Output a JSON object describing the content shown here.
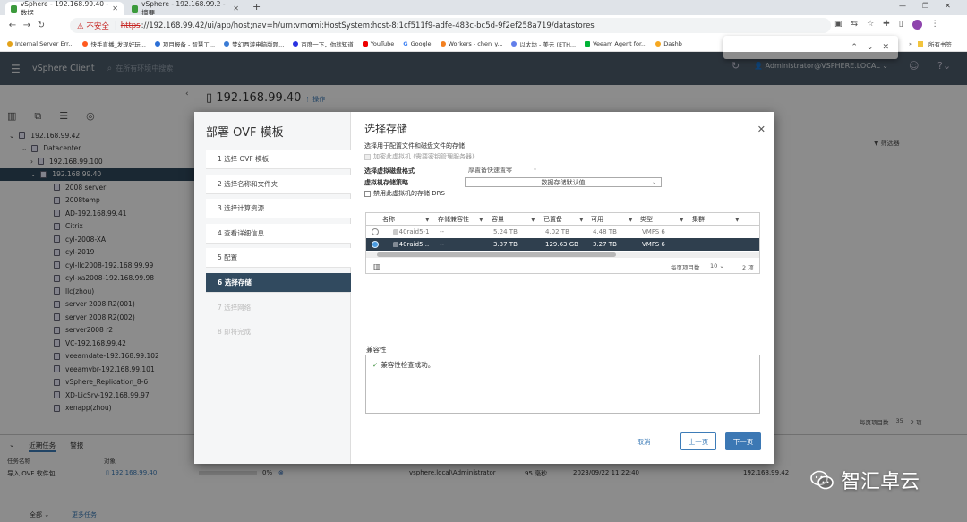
{
  "browser": {
    "tabs": [
      {
        "title": "vSphere - 192.168.99.40 - 数据"
      },
      {
        "title": "vSphere - 192.168.99.2 - 摘要"
      }
    ],
    "address": {
      "warning": "不安全",
      "scheme": "https",
      "rest": "://192.168.99.42/ui/app/host;nav=h/urn:vmomi:HostSystem:host-8:1cf511f9-adfe-483c-bc5d-9f2ef258a719/datastores"
    },
    "bookmarks": [
      "Internal Server Err...",
      "快手直播_发现好玩...",
      "项目报备 - 智慧工...",
      "梦幻西游电脑版题...",
      "百度一下，你就知道",
      "YouTube",
      "Google",
      "Workers - chen_y...",
      "以太坊 - 美元 (ETH...",
      "Veeam Agent for...",
      "Dashb"
    ],
    "all_bookmarks": "所有书签"
  },
  "vsphere": {
    "app_title": "vSphere Client",
    "search_placeholder": "在所有环境中搜索",
    "user": "Administrator@VSPHERE.LOCAL",
    "host_title": "192.168.99.40",
    "actions_label": "操作",
    "filter_label": "筛选器",
    "tree": [
      {
        "label": "192.168.99.42",
        "indent": 0,
        "selected": false
      },
      {
        "label": "Datacenter",
        "indent": 1,
        "selected": false
      },
      {
        "label": "192.168.99.100",
        "indent": 2,
        "selected": false
      },
      {
        "label": "192.168.99.40",
        "indent": 2,
        "selected": true
      },
      {
        "label": "2008 server",
        "indent": 3,
        "selected": false
      },
      {
        "label": "2008temp",
        "indent": 3,
        "selected": false
      },
      {
        "label": "AD-192.168.99.41",
        "indent": 3,
        "selected": false
      },
      {
        "label": "Citrix",
        "indent": 3,
        "selected": false
      },
      {
        "label": "cyl-2008-XA",
        "indent": 3,
        "selected": false
      },
      {
        "label": "cyl-2019",
        "indent": 3,
        "selected": false
      },
      {
        "label": "cyl-llc2008-192.168.99.99",
        "indent": 3,
        "selected": false
      },
      {
        "label": "cyl-xa2008-192.168.99.98",
        "indent": 3,
        "selected": false
      },
      {
        "label": "llc(zhou)",
        "indent": 3,
        "selected": false
      },
      {
        "label": "server 2008 R2(001)",
        "indent": 3,
        "selected": false
      },
      {
        "label": "server 2008 R2(002)",
        "indent": 3,
        "selected": false
      },
      {
        "label": "server2008 r2",
        "indent": 3,
        "selected": false
      },
      {
        "label": "VC-192.168.99.42",
        "indent": 3,
        "selected": false
      },
      {
        "label": "veeamdate-192.168.99.102",
        "indent": 3,
        "selected": false
      },
      {
        "label": "veeamvbr-192.168.99.101",
        "indent": 3,
        "selected": false
      },
      {
        "label": "vSphere_Replication_8-6",
        "indent": 3,
        "selected": false
      },
      {
        "label": "XD-LicSrv-192.168.99.97",
        "indent": 3,
        "selected": false
      },
      {
        "label": "xenapp(zhou)",
        "indent": 3,
        "selected": false
      }
    ],
    "right_footer": {
      "per_page_label": "每页项目数",
      "per_page": "35",
      "count": "2 项"
    },
    "bottom": {
      "tabs": [
        "近期任务",
        "警报"
      ],
      "columns": [
        "任务名称",
        "对象"
      ],
      "task": {
        "name": "导入 OVF 软件包",
        "target": "192.168.99.40",
        "progress": "0%",
        "initiator": "vsphere.local\\Administrator",
        "queued": "95 毫秒",
        "start": "2023/09/22 11:22:40",
        "server": "192.168.99.42"
      },
      "filter_all": "全部",
      "more_tasks": "更多任务"
    }
  },
  "modal": {
    "title": "部署 OVF 模板",
    "steps": [
      {
        "label": "1  选择 OVF 模板",
        "state": "done"
      },
      {
        "label": "2  选择名称和文件夹",
        "state": "done"
      },
      {
        "label": "3  选择计算资源",
        "state": "done"
      },
      {
        "label": "4  查看详细信息",
        "state": "done"
      },
      {
        "label": "5  配置",
        "state": "done"
      },
      {
        "label": "6  选择存储",
        "state": "active"
      },
      {
        "label": "7  选择网络",
        "state": "pending"
      },
      {
        "label": "8  即将完成",
        "state": "pending"
      }
    ],
    "page_title": "选择存储",
    "intro": "选择用于配置文件和磁盘文件的存储",
    "encrypt_label": "加密此虚拟机 (需要密钥管理服务器)",
    "disk_format_label": "选择虚拟磁盘格式",
    "disk_format_value": "厚置备快速置零",
    "policy_label": "虚拟机存储策略",
    "policy_value": "数据存储默认值",
    "drs_label": "禁用此虚拟机的存储 DRS",
    "table": {
      "columns": [
        "名称",
        "存储兼容性",
        "容量",
        "已置备",
        "可用",
        "类型",
        "集群"
      ],
      "rows": [
        {
          "name": "40raid5-1",
          "compat": "--",
          "capacity": "5.24 TB",
          "provisioned": "4.02 TB",
          "free": "4.48 TB",
          "type": "VMFS 6",
          "cluster": "",
          "selected": false
        },
        {
          "name": "40raid5...",
          "compat": "--",
          "capacity": "3.37 TB",
          "provisioned": "129.63 GB",
          "free": "3.27 TB",
          "type": "VMFS 6",
          "cluster": "",
          "selected": true
        }
      ],
      "per_page_label": "每页项目数",
      "per_page": "10",
      "count": "2 项"
    },
    "compat_label": "兼容性",
    "compat_message": "兼容性检查成功。",
    "buttons": {
      "cancel": "取消",
      "back": "上一页",
      "next": "下一页"
    }
  },
  "watermark": {
    "text": "智汇卓云"
  }
}
